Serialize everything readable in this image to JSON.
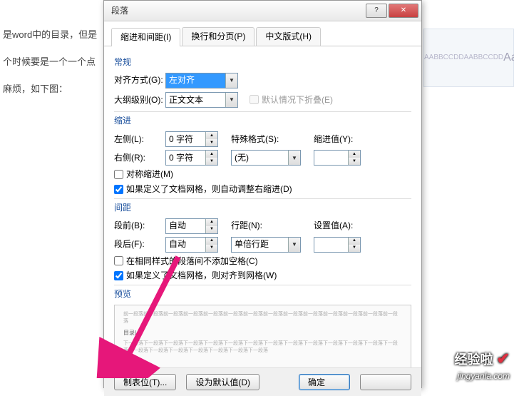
{
  "background": {
    "line1": "是word中的目录，但是",
    "line2": "个时候要是一个一个点",
    "line3": "麻烦，如下图："
  },
  "ribbon_hint": [
    "AABBCCDD",
    "AABBCCDD",
    "AaBb"
  ],
  "dialog": {
    "title": "段落",
    "win": {
      "help": "?",
      "close": "✕"
    },
    "tabs": {
      "indent": "缩进和间距(I)",
      "linebreak": "换行和分页(P)",
      "chinese": "中文版式(H)"
    },
    "sections": {
      "general": "常规",
      "indent": "缩进",
      "spacing": "间距",
      "preview": "预览"
    },
    "labels": {
      "alignment": "对齐方式(G):",
      "outline": "大纲级别(O):",
      "left": "左侧(L):",
      "right": "右侧(R):",
      "special": "特殊格式(S):",
      "by": "缩进值(Y):",
      "before": "段前(B):",
      "after": "段后(F):",
      "linespace": "行距(N):",
      "at": "设置值(A):"
    },
    "values": {
      "alignment": "左对齐",
      "outline": "正文文本",
      "left": "0 字符",
      "right": "0 字符",
      "special": "(无)",
      "by": "",
      "before": "自动",
      "after": "自动",
      "linespace": "单倍行距",
      "at": ""
    },
    "checks": {
      "collapse": "默认情况下折叠(E)",
      "mirror": "对称缩进(M)",
      "grid_indent": "如果定义了文档网格，则自动调整右缩进(D)",
      "nospace": "在相同样式的段落间不添加空格(C)",
      "grid_align": "如果定义了文档网格，则对齐到网格(W)"
    },
    "preview_text": {
      "before": "前一段落前一段落前一段落前一段落前一段落前一段落前一段落前一段落前一段落前一段落前一段落前一段落前一段落前一段落",
      "sample": "目录I",
      "after": "下一段落下一段落下一段落下一段落下一段落下一段落下一段落下一段落下一段落下一段落下一段落下一段落下一段落下一段落下一段落下一段落下一段落下一段落下一段落下一段落下一段落"
    },
    "buttons": {
      "tabs": "制表位(T)...",
      "default": "设为默认值(D)",
      "ok": "确定",
      "cancel": ""
    }
  },
  "watermark": {
    "brand": "经验啦",
    "url": "jingyanla.com"
  }
}
